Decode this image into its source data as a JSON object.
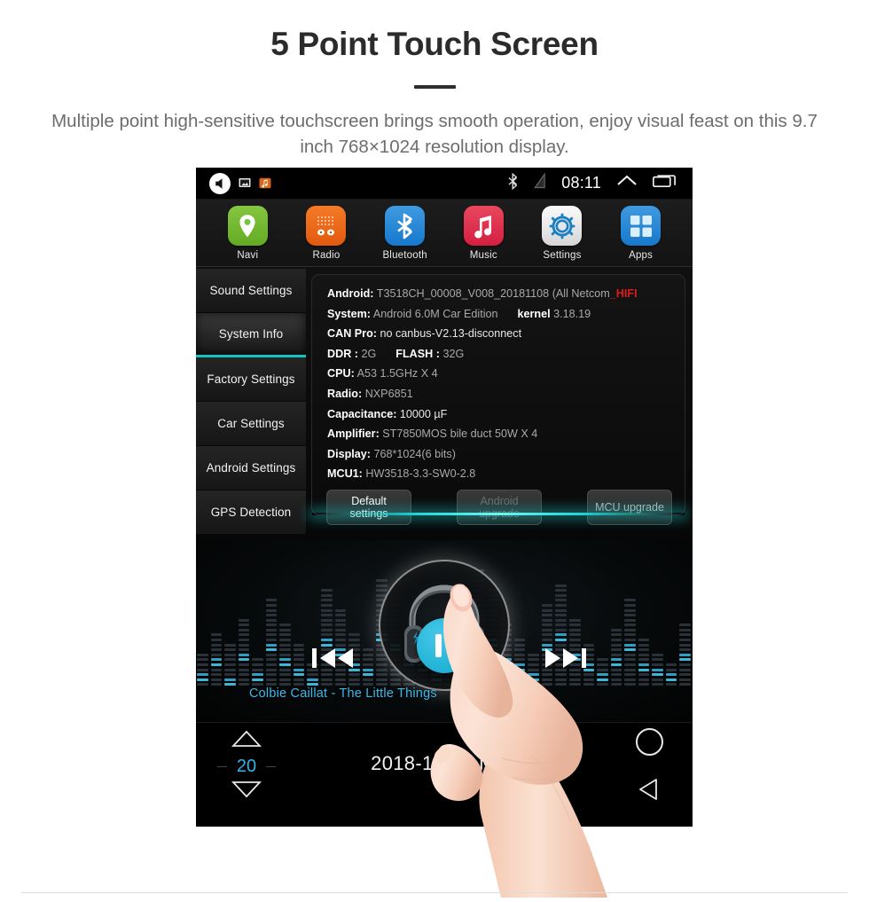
{
  "heading": {
    "title": "5 Point Touch Screen",
    "subtitle": "Multiple point high-sensitive touchscreen brings smooth operation, enjoy visual feast on this 9.7 inch 768×1024 resolution display."
  },
  "device": {
    "statusbar": {
      "speaker_icon": "speaker-icon",
      "screenshot_icon": "screenshot-icon",
      "music_notification_icon": "music-notification-icon",
      "bluetooth_icon": "bluetooth-icon",
      "no_signal_icon": "no-signal-icon",
      "time": "08:11",
      "chevron_up_icon": "chevron-up-icon",
      "recents_icon": "recents-icon"
    },
    "dock": [
      {
        "label": "Navi",
        "icon": "location-pin-icon",
        "color": "#7ac143"
      },
      {
        "label": "Radio",
        "icon": "radio-icon",
        "color": "#ef6c17"
      },
      {
        "label": "Bluetooth",
        "icon": "bluetooth-icon",
        "color": "#2a8ad8"
      },
      {
        "label": "Music",
        "icon": "music-note-icon",
        "color": "#dd2f4e"
      },
      {
        "label": "Settings",
        "icon": "gear-icon",
        "color": "#e9e9e9"
      },
      {
        "label": "Apps",
        "icon": "grid-apps-icon",
        "color": "#2a8ad8"
      }
    ],
    "sidebar": [
      {
        "label": "Sound Settings",
        "active": false
      },
      {
        "label": "System Info",
        "active": true
      },
      {
        "label": "Factory Settings",
        "active": false
      },
      {
        "label": "Car Settings",
        "active": false
      },
      {
        "label": "Android Settings",
        "active": false
      },
      {
        "label": "GPS Detection",
        "active": false
      }
    ],
    "system_info": {
      "android_key": "Android:",
      "android_value": "T3518CH_00008_V008_20181108  (All Netcom",
      "android_suffix": "_HIFI",
      "system_key": "System:",
      "system_value": "Android 6.0M Car Edition",
      "kernel_key": "kernel",
      "kernel_value": "3.18.19",
      "canpro_key": "CAN Pro:",
      "canpro_value": "no canbus-V2.13-disconnect",
      "ddr_key": "DDR :",
      "ddr_value": "2G",
      "flash_key": "FLASH :",
      "flash_value": "32G",
      "cpu_key": "CPU:",
      "cpu_value": "A53 1.5GHz X 4",
      "radio_key": "Radio:",
      "radio_value": "NXP6851",
      "capacitance_key": "Capacitance:",
      "capacitance_value": "10000 µF",
      "amplifier_key": "Amplifier:",
      "amplifier_value": "ST7850MOS bile duct 50W X 4",
      "display_key": "Display:",
      "display_value": "768*1024(6 bits)",
      "mcu_key": "MCU1:",
      "mcu_value": "HW3518-3.3-SW0-2.8"
    },
    "buttons": {
      "default_settings": "Default\nsettings",
      "default_settings_l1": "Default",
      "default_settings_l2": "settings",
      "android_upgrade_l1": "Android",
      "android_upgrade_l2": "upgrade",
      "mcu_upgrade": "MCU upgrade"
    },
    "player": {
      "track": "Colbie Caillat - The Little Things",
      "prev_icon": "previous-track-icon",
      "play_icon": "pause-icon",
      "next_icon": "next-track-icon"
    },
    "bottom": {
      "volume": "20",
      "volume_up_icon": "triangle-up-icon",
      "volume_down_icon": "triangle-down-icon",
      "date": "2018-10-15  Mon",
      "home_icon": "home-circle-icon",
      "back_icon": "back-triangle-icon"
    },
    "accent_color": "#17c2c2",
    "highlight_color": "#2fb6e8"
  }
}
